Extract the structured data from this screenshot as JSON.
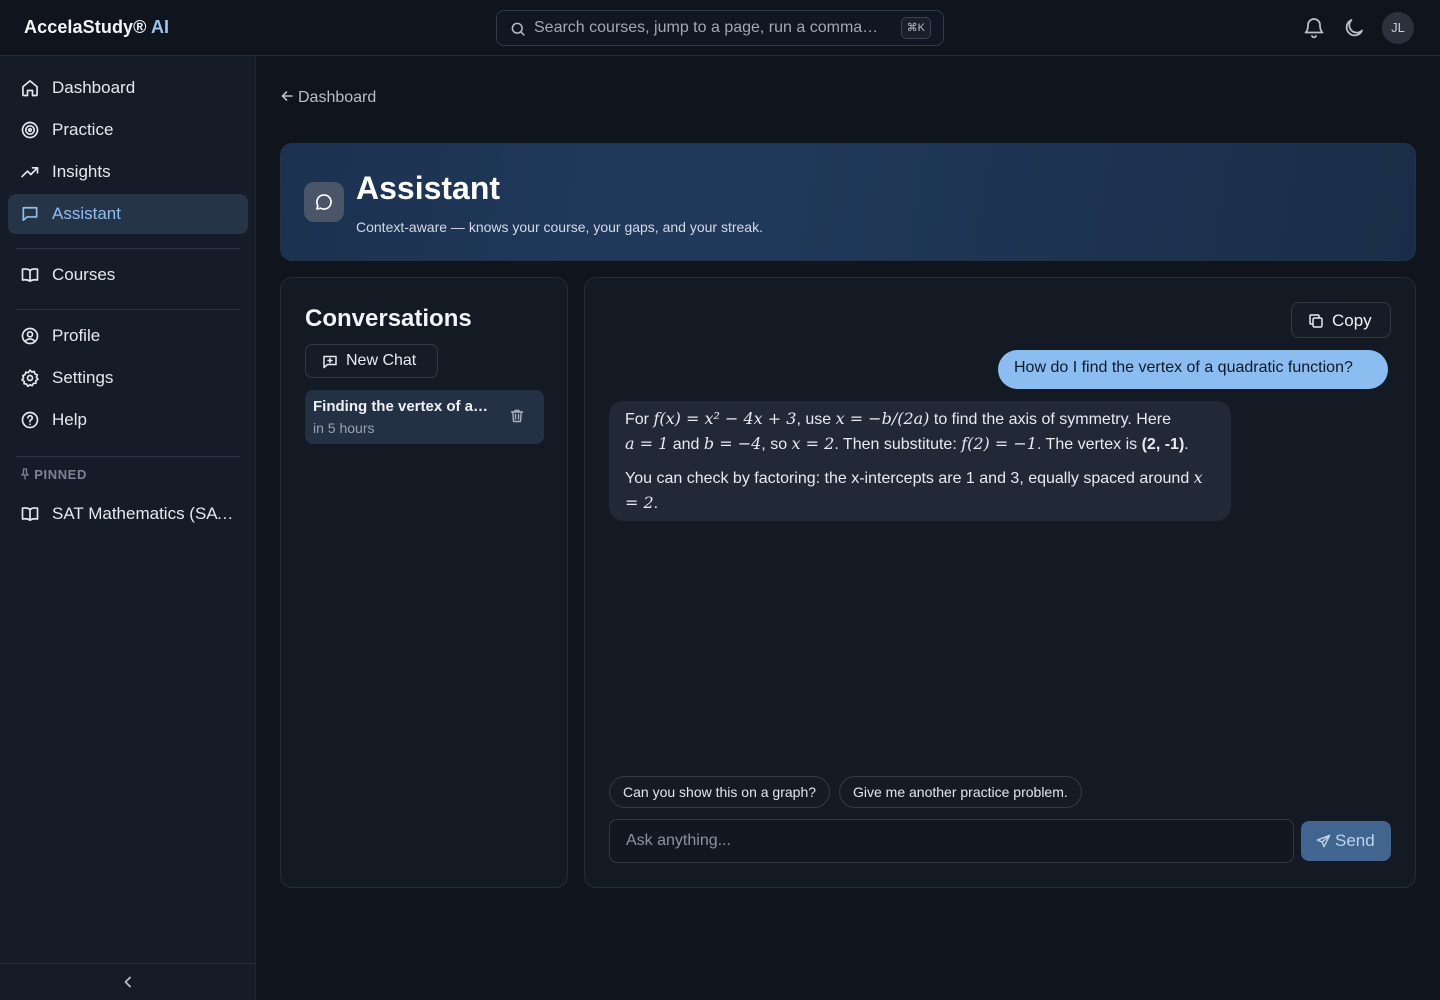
{
  "app": {
    "brand_name": "AccelaStudy®",
    "brand_suffix": "AI",
    "user_initials": "JL"
  },
  "search": {
    "placeholder": "Search courses, jump to a page, run a comma…",
    "shortcut": "⌘K"
  },
  "sidebar": {
    "items": [
      {
        "label": "Dashboard",
        "icon": "home-icon"
      },
      {
        "label": "Practice",
        "icon": "target-icon"
      },
      {
        "label": "Insights",
        "icon": "trending-up-icon"
      },
      {
        "label": "Assistant",
        "icon": "message-icon",
        "active": true
      },
      {
        "label": "Courses",
        "icon": "book-icon"
      },
      {
        "label": "Profile",
        "icon": "user-circle-icon"
      },
      {
        "label": "Settings",
        "icon": "gear-icon"
      },
      {
        "label": "Help",
        "icon": "help-icon"
      }
    ],
    "pinned_heading": "PINNED",
    "pinned": [
      {
        "label": "SAT Mathematics (SAT…",
        "icon": "book-icon"
      }
    ]
  },
  "breadcrumb": {
    "back_label": "Dashboard"
  },
  "hero": {
    "title": "Assistant",
    "subtitle": "Context-aware — knows your course, your gaps, and your streak."
  },
  "conversations": {
    "title": "Conversations",
    "new_chat_label": "New Chat",
    "items": [
      {
        "title": "Finding the vertex of a…",
        "time": "in 5 hours"
      }
    ]
  },
  "chat": {
    "copy_label": "Copy",
    "user_message": "How do I find the vertex of a quadratic function?",
    "assistant_message": {
      "p1": {
        "t1": "For ",
        "m1": "f(x) = x² − 4x + 3",
        "t2": ", use ",
        "m2": "x = −b/(2a)",
        "t3": " to find the axis of symmetry. Here",
        "m3": "a = 1",
        "t4": " and ",
        "m4": "b = −4",
        "t5": ", so ",
        "m5": "x = 2",
        "t6": ". Then substitute: ",
        "m6": "f(2) = −1",
        "t7": ". The vertex is ",
        "b1": "(2, -1)",
        "t8": "."
      },
      "p2": {
        "t1": "You can check by factoring: the x-intercepts are 1 and 3, equally spaced around ",
        "m1": "x = 2",
        "t2": "."
      }
    },
    "suggestions": [
      "Can you show this on a graph?",
      "Give me another practice problem."
    ],
    "input_placeholder": "Ask anything...",
    "send_label": "Send"
  },
  "colors": {
    "accent": "#8bbdf0",
    "send_button": "#41658e",
    "background": "#0f141d",
    "sidebar": "#161c27"
  }
}
